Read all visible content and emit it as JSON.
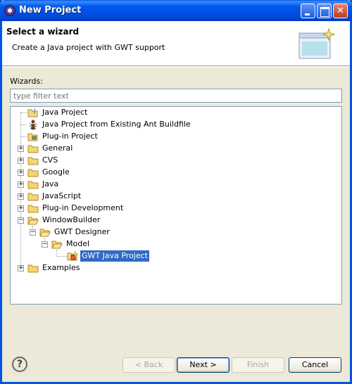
{
  "window": {
    "title": "New Project"
  },
  "banner": {
    "title": "Select a wizard",
    "description": "Create a Java project with GWT support"
  },
  "wizards": {
    "label": "Wizards:",
    "filter_placeholder": "type filter text",
    "tree": [
      {
        "label": "Java Project",
        "icon": "java-project-icon"
      },
      {
        "label": "Java Project from Existing Ant Buildfile",
        "icon": "ant-icon"
      },
      {
        "label": "Plug-in Project",
        "icon": "plugin-project-icon"
      },
      {
        "label": "General",
        "icon": "folder-icon"
      },
      {
        "label": "CVS",
        "icon": "folder-icon"
      },
      {
        "label": "Google",
        "icon": "folder-icon"
      },
      {
        "label": "Java",
        "icon": "folder-icon"
      },
      {
        "label": "JavaScript",
        "icon": "folder-icon"
      },
      {
        "label": "Plug-in Development",
        "icon": "folder-icon"
      },
      {
        "label": "WindowBuilder",
        "icon": "folder-open-icon"
      },
      {
        "label": "GWT Designer",
        "icon": "folder-open-icon"
      },
      {
        "label": "Model",
        "icon": "folder-open-icon"
      },
      {
        "label": "GWT Java Project",
        "icon": "gwt-project-icon",
        "selected": true
      },
      {
        "label": "Examples",
        "icon": "folder-icon"
      }
    ]
  },
  "buttons": {
    "help": "?",
    "back": "< Back",
    "next": "Next >",
    "finish": "Finish",
    "cancel": "Cancel"
  }
}
